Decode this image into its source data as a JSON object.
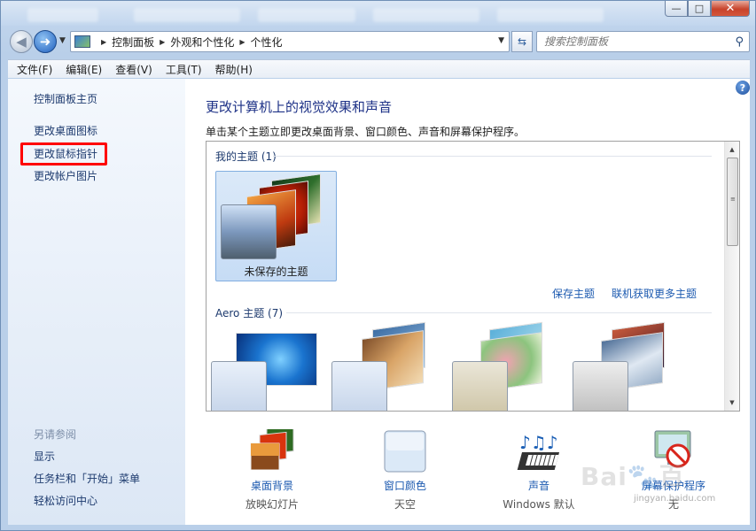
{
  "window": {
    "controls": {
      "minimize": "—",
      "maximize": "□",
      "close": "✕"
    },
    "icons": {
      "nav_back": "arrow-left-icon",
      "nav_forward": "arrow-right-icon",
      "refresh": "refresh-icon",
      "search": "magnifier-icon",
      "help": "question-icon"
    }
  },
  "address": {
    "crumbs": [
      "控制面板",
      "外观和个性化",
      "个性化"
    ]
  },
  "search": {
    "placeholder": "搜索控制面板"
  },
  "menu": [
    "文件(F)",
    "编辑(E)",
    "查看(V)",
    "工具(T)",
    "帮助(H)"
  ],
  "sidebar": {
    "home": "控制面板主页",
    "links": [
      "更改桌面图标",
      "更改鼠标指针",
      "更改帐户图片"
    ],
    "highlighted": "更改鼠标指针",
    "see_also_title": "另请参阅",
    "see_also": [
      "显示",
      "任务栏和「开始」菜单",
      "轻松访问中心"
    ]
  },
  "main": {
    "title": "更改计算机上的视觉效果和声音",
    "description": "单击某个主题立即更改桌面背景、窗口颜色、声音和屏幕保护程序。",
    "my_themes_header": "我的主题 (1)",
    "unsaved_theme": "未保存的主题",
    "save_theme": "保存主题",
    "get_more_themes": "联机获取更多主题",
    "aero_header": "Aero 主题 (7)"
  },
  "settings": [
    {
      "label": "桌面背景",
      "value": "放映幻灯片",
      "icon": "desktop-background-icon"
    },
    {
      "label": "窗口颜色",
      "value": "天空",
      "icon": "window-color-icon"
    },
    {
      "label": "声音",
      "value": "Windows 默认",
      "icon": "sound-icon"
    },
    {
      "label": "屏幕保护程序",
      "value": "无",
      "icon": "screensaver-icon"
    }
  ],
  "watermark": {
    "main": "Bai🐾百",
    "sub": "jingyan.baidu.com"
  },
  "colors": {
    "title_blue": "#1e3287",
    "link_blue": "#1c5ab0",
    "highlight_red": "#ff0000"
  }
}
